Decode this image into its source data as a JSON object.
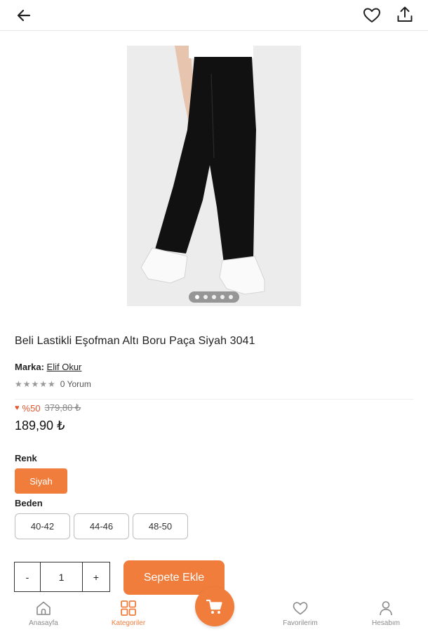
{
  "header": {
    "back_icon": "arrow-left-icon",
    "favorite_icon": "heart-outline-icon",
    "share_icon": "share-upload-icon"
  },
  "gallery": {
    "dot_count": 5,
    "active_index": 0
  },
  "product": {
    "title": "Beli Lastikli Eşofman Altı Boru Paça Siyah 3041",
    "brand_label": "Marka:",
    "brand_name": "Elif Okur",
    "stars": "★★★★★",
    "reviews": "0 Yorum",
    "discount": "%50",
    "old_price": "379,80 ₺",
    "price": "189,90 ₺"
  },
  "options": {
    "color_label": "Renk",
    "color_selected": "Siyah",
    "size_label": "Beden",
    "sizes": [
      "40-42",
      "44-46",
      "48-50"
    ]
  },
  "cart": {
    "minus": "-",
    "quantity": "1",
    "plus": "+",
    "add_label": "Sepete Ekle"
  },
  "nav": {
    "items": [
      {
        "label": "Anasayfa",
        "icon": "home-icon"
      },
      {
        "label": "Kategoriler",
        "icon": "grid-icon"
      },
      {
        "label": "Favorilerim",
        "icon": "heart-icon"
      },
      {
        "label": "Hesabım",
        "icon": "user-icon"
      }
    ],
    "cart_icon": "cart-icon"
  },
  "colors": {
    "accent": "#f07d3c",
    "discount": "#e4572e"
  }
}
